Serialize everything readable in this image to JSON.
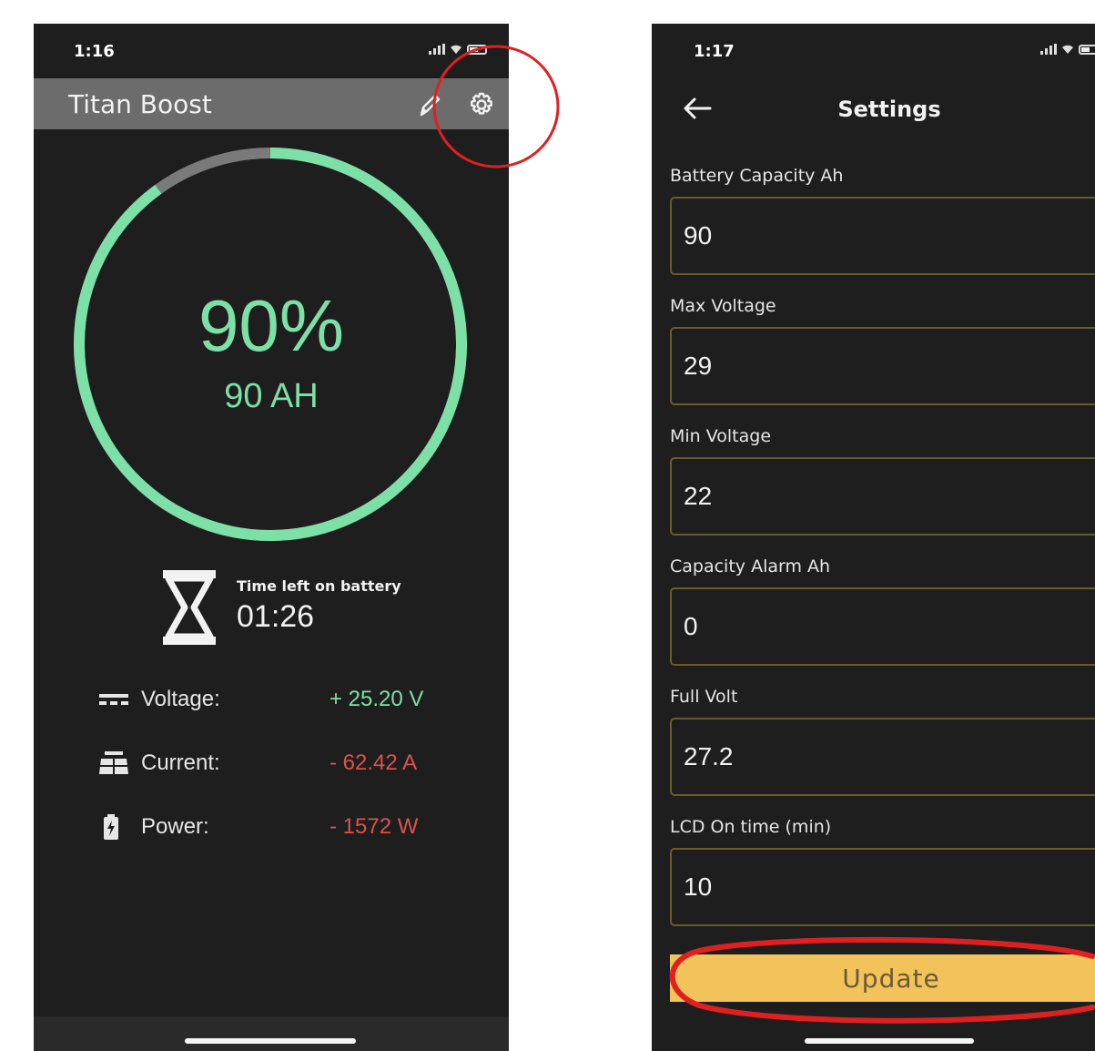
{
  "left": {
    "status": {
      "time": "1:16"
    },
    "header": {
      "title": "Titan Boost",
      "edit_icon": "pencil-icon",
      "settings_icon": "gear-icon"
    },
    "gauge": {
      "percent_text": "90%",
      "ah_text": "90 AH",
      "fill_fraction": 0.9,
      "fill_color": "#7de0a6",
      "track_color": "#7a7a7a"
    },
    "time_left": {
      "label": "Time left on battery",
      "value": "01:26"
    },
    "metrics": [
      {
        "label": "Voltage:",
        "value": "+ 25.20 V",
        "color": "#7de0a6",
        "icon": "dc-voltage-icon"
      },
      {
        "label": "Current:",
        "value": "- 62.42 A",
        "color": "#d9534f",
        "icon": "solar-panel-icon"
      },
      {
        "label": "Power:",
        "value": "- 1572 W",
        "color": "#d9534f",
        "icon": "battery-charge-icon"
      }
    ]
  },
  "right": {
    "status": {
      "time": "1:17"
    },
    "header": {
      "title": "Settings",
      "back_icon": "arrow-left-icon"
    },
    "fields": [
      {
        "label": "Battery Capacity Ah",
        "value": "90"
      },
      {
        "label": "Max Voltage",
        "value": "29"
      },
      {
        "label": "Min Voltage",
        "value": "22"
      },
      {
        "label": "Capacity Alarm Ah",
        "value": "0"
      },
      {
        "label": "Full Volt",
        "value": "27.2"
      },
      {
        "label": "LCD On time (min)",
        "value": "10"
      }
    ],
    "update_button": "Update"
  },
  "colors": {
    "accent_green": "#7de0a6",
    "negative_red": "#d9534f",
    "button_yellow": "#f2c35b",
    "annotation_red": "#e02020"
  }
}
